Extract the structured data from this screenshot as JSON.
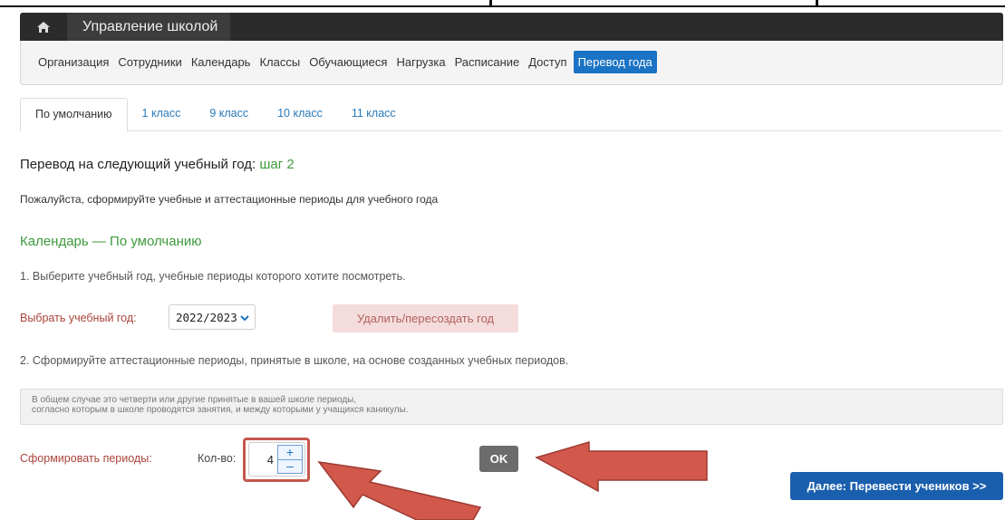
{
  "navbar": {
    "brand": "Управление школой",
    "home_icon": "home-icon"
  },
  "menu": {
    "items": [
      "Организация",
      "Сотрудники",
      "Календарь",
      "Классы",
      "Обучающиеся",
      "Нагрузка",
      "Расписание",
      "Доступ",
      "Перевод года"
    ],
    "active": "Перевод года"
  },
  "tabs": [
    "По умолчанию",
    "1 класс",
    "9 класс",
    "10 класс",
    "11 класс"
  ],
  "page": {
    "title": "Перевод на следующий учебный год:",
    "step": "шаг 2",
    "subtitle": "Пожалуйста, сформируйте учебные и аттестационные периоды для учебного года",
    "calendar_heading": "Календарь — По умолчанию",
    "step1_text": "1. Выберите учебный год, учебные периоды которого хотите посмотреть.",
    "year_label": "Выбрать учебный год:",
    "year_value": "2022/2023",
    "delete_button": "Удалить/пересоздать год",
    "step2_text": "2. Сформируйте аттестационные периоды, принятые в школе, на основе созданных учебных периодов.",
    "note_line1": "В общем случае это четверти или другие принятые в вашей школе периоды,",
    "note_line2": "согласно которым в школе проводятся занятия, и между которыми у учащихся каникулы.",
    "form_label": "Сформировать периоды:",
    "qty_label": "Кол-во:",
    "qty_value": "4",
    "plus": "+",
    "minus": "–",
    "ok_button": "OK",
    "next_button": "Далее: Перевести учеников >>"
  },
  "colors": {
    "accent": "#1a73c4",
    "green": "#3e9a3e",
    "label_red": "#a9443a",
    "arrow": "#d2584c"
  }
}
